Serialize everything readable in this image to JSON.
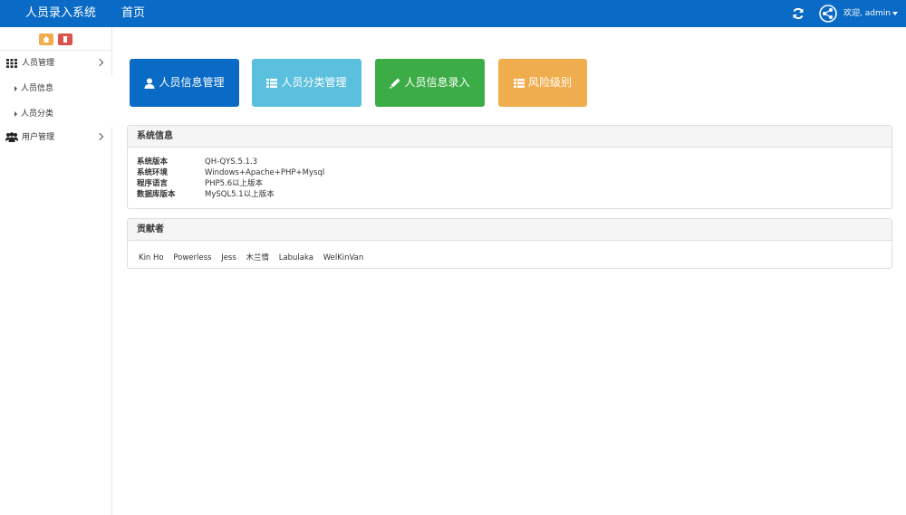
{
  "header": {
    "brand": "人员录入系统",
    "home_link": "首页",
    "welcome": "欢迎, admin"
  },
  "sidebar": {
    "menu": [
      {
        "label": "人员管理",
        "icon": "grid-icon",
        "expanded": true,
        "children": [
          {
            "label": "人员信息"
          },
          {
            "label": "人员分类"
          }
        ]
      },
      {
        "label": "用户管理",
        "icon": "users-icon",
        "expanded": false
      }
    ]
  },
  "tiles": [
    {
      "label": "人员信息管理",
      "icon": "user-icon",
      "color": "#0a6bc6"
    },
    {
      "label": "人员分类管理",
      "icon": "list-icon",
      "color": "#5bc0de"
    },
    {
      "label": "人员信息录入",
      "icon": "pencil-icon",
      "color": "#3cad46"
    },
    {
      "label": "风险级别",
      "icon": "list-icon",
      "color": "#f0ad4e"
    }
  ],
  "system_info": {
    "title": "系统信息",
    "rows": [
      {
        "key": "系统版本",
        "value": "QH-QYS.5.1.3"
      },
      {
        "key": "系统环境",
        "value": "Windows+Apache+PHP+Mysql"
      },
      {
        "key": "程序语言",
        "value": "PHP5.6以上版本"
      },
      {
        "key": "数据库版本",
        "value": "MySQL5.1以上版本"
      }
    ]
  },
  "contributors": {
    "title": "贡献者",
    "names": [
      "Kin Ho",
      "Powerless",
      "Jess",
      "木兰情",
      "Labulaka",
      "WelKinVan"
    ]
  }
}
